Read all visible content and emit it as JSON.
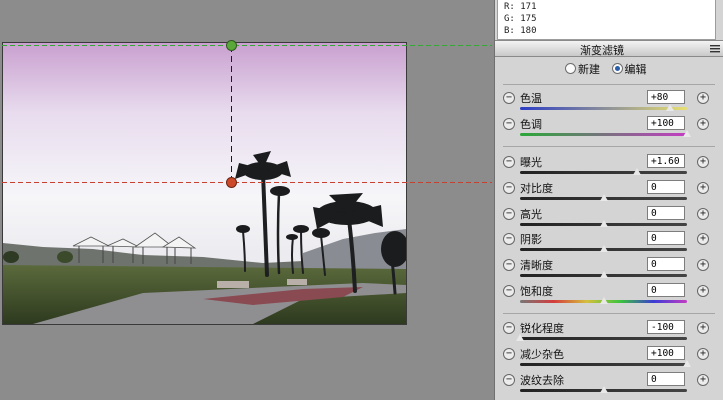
{
  "info": {
    "r": "R:  171",
    "g": "G:  175",
    "b": "B:  180"
  },
  "panel": {
    "title": "渐变滤镜",
    "modes": [
      {
        "label": "新建",
        "selected": false
      },
      {
        "label": "编辑",
        "selected": true
      }
    ]
  },
  "groups": [
    [
      {
        "label": "色温",
        "value": "+80",
        "level": 0.9,
        "track": "temp"
      },
      {
        "label": "色调",
        "value": "+100",
        "level": 1.0,
        "track": "tint"
      }
    ],
    [
      {
        "label": "曝光",
        "value": "+1.60",
        "level": 0.7,
        "track": "dark"
      },
      {
        "label": "对比度",
        "value": "0",
        "level": 0.5,
        "track": "dark"
      },
      {
        "label": "高光",
        "value": "0",
        "level": 0.5,
        "track": "dark"
      },
      {
        "label": "阴影",
        "value": "0",
        "level": 0.5,
        "track": "dark"
      },
      {
        "label": "清晰度",
        "value": "0",
        "level": 0.5,
        "track": "dark"
      },
      {
        "label": "饱和度",
        "value": "0",
        "level": 0.5,
        "track": "sat"
      }
    ],
    [
      {
        "label": "锐化程度",
        "value": "-100",
        "level": 0.0,
        "track": "dark"
      },
      {
        "label": "减少杂色",
        "value": "+100",
        "level": 1.0,
        "track": "dark"
      },
      {
        "label": "波纹去除",
        "value": "0",
        "level": 0.5,
        "track": "dark"
      }
    ]
  ],
  "colors": {
    "guide_green": "#36a836",
    "guide_red": "#c8412f",
    "pin_green": "#5aa83a",
    "pin_red": "#cc4a2a"
  },
  "icons": {
    "minus": "minus-circle-icon",
    "plus": "plus-circle-icon",
    "menu": "panel-menu-icon"
  }
}
